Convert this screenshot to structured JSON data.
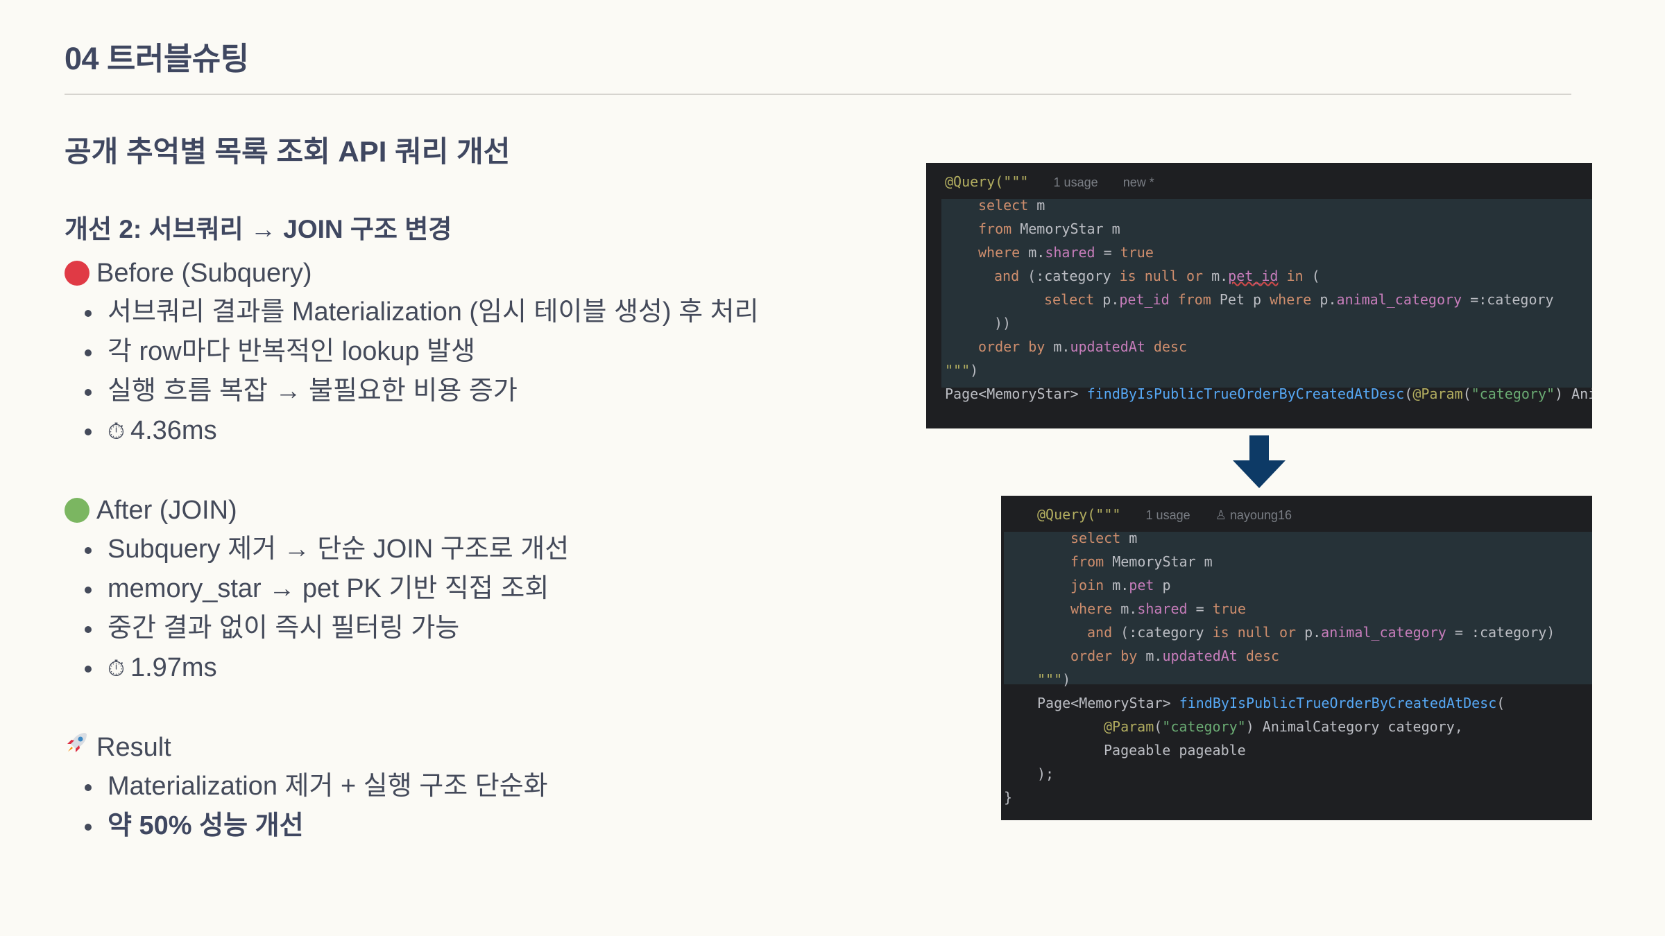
{
  "header": {
    "section_title": "04 트러블슈팅",
    "subtitle": "공개 추억별 목록 조회 API 쿼리 개선"
  },
  "step_title": "개선 2: 서브쿼리 → JOIN 구조 변경",
  "before": {
    "title": "Before (Subquery)",
    "items": [
      "서브쿼리 결과를 Materialization (임시 테이블 생성) 후 처리",
      "각 row마다 반복적인 lookup 발생",
      "실행 흐름 복잡 → 불필요한 비용 증가",
      "4.36ms"
    ]
  },
  "after": {
    "title": "After (JOIN)",
    "items": [
      "Subquery 제거 → 단순 JOIN 구조로 개선",
      "memory_star → pet PK 기반 직접 조회",
      "중간 결과 없이 즉시 필터링 가능",
      "1.97ms"
    ]
  },
  "result": {
    "title": "Result",
    "items": [
      "Materialization 제거 + 실행 구조 단순화",
      "약 50% 성능 개선"
    ]
  },
  "icons": {
    "before_dot": "red-circle-icon",
    "after_dot": "green-circle-icon",
    "result": "rocket-icon",
    "timer": "stopwatch-icon",
    "arrow": "arrow-down-icon"
  },
  "colors": {
    "before_dot": "#e03a45",
    "after_dot": "#7bb661",
    "arrow": "#0d3a66",
    "code_bg": "#1e1f22"
  },
  "code_before": {
    "usage": "1 usage",
    "author": "new *",
    "lines": [
      "@Query(\"\"\"",
      "select m",
      "from MemoryStar m",
      "where m.shared = true",
      "and (:category is null or m.pet_id in (",
      "select p.pet_id from Pet p where p.animal_category =:category",
      "))",
      "order by m.updatedAt desc",
      "\"\"\")",
      "Page<MemoryStar> findByIsPublicTrueOrderByCreatedAtDesc(@Param(\"category\") Ani"
    ]
  },
  "code_after": {
    "usage": "1 usage",
    "author": "nayoung16",
    "lines": [
      "@Query(\"\"\"",
      "select m",
      "from MemoryStar m",
      "join m.pet p",
      "where m.shared = true",
      "and (:category is null or p.animal_category = :category)",
      "order by m.updatedAt desc",
      "\"\"\")",
      "Page<MemoryStar> findByIsPublicTrueOrderByCreatedAtDesc(",
      "@Param(\"category\") AnimalCategory category,",
      "Pageable pageable",
      ");",
      "}"
    ]
  }
}
